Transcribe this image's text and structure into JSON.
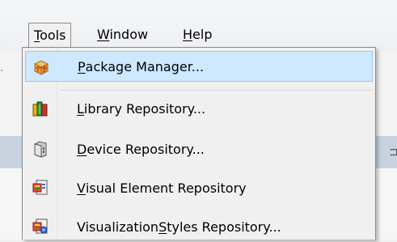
{
  "menubar": {
    "items": [
      {
        "label_u": "T",
        "label_rest": "ools"
      },
      {
        "label_u": "W",
        "label_rest": "indow"
      },
      {
        "label_u": "H",
        "label_rest": "elp"
      }
    ]
  },
  "dropdown": {
    "items": [
      {
        "label_u": "P",
        "label_rest": "ackage Manager...",
        "icon": "package-manager-icon",
        "highlighted": true
      },
      {
        "label_u": "L",
        "label_rest": "ibrary Repository...",
        "icon": "library-repository-icon"
      },
      {
        "label_u": "D",
        "label_rest": "evice Repository...",
        "icon": "device-repository-icon"
      },
      {
        "label_u": "V",
        "label_rest": "isual Element Repository",
        "icon": "visual-element-repository-icon"
      },
      {
        "label_pre": "Visualization ",
        "label_u": "S",
        "label_rest": "tyles Repository...",
        "icon": "visualization-styles-repository-icon"
      }
    ]
  },
  "colors": {
    "highlight_bg": "#cde8ff",
    "highlight_border": "#99c9ef",
    "menu_border": "#8a8a8a",
    "document_strip": "#c9d3df"
  }
}
